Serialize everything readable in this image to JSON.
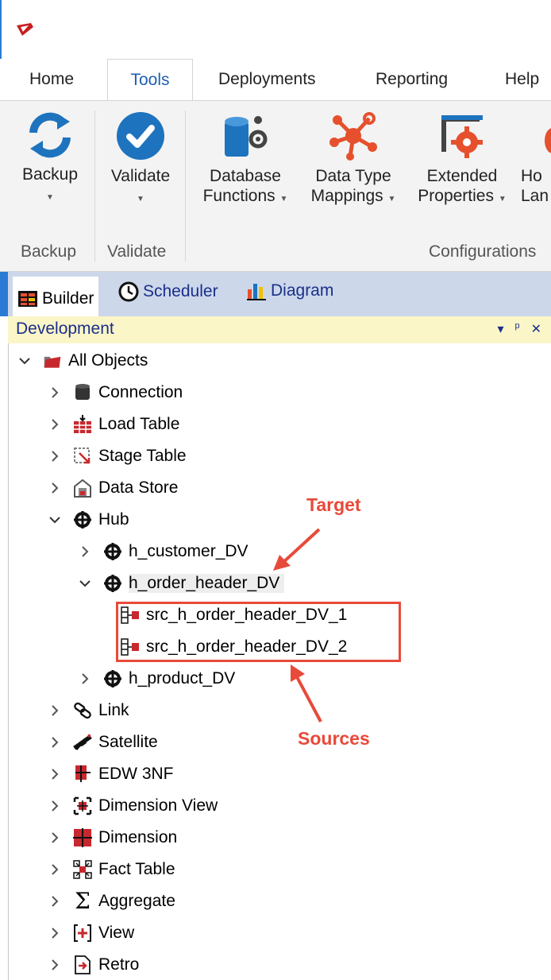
{
  "ribbon": {
    "tabs": [
      "Home",
      "Tools",
      "Deployments",
      "Reporting",
      "Help"
    ],
    "buttons": {
      "backup": "Backup",
      "validate": "Validate",
      "db_functions_1": "Database",
      "db_functions_2": "Functions",
      "dtm_1": "Data Type",
      "dtm_2": "Mappings",
      "ext_1": "Extended",
      "ext_2": "Properties",
      "hl_1": "Ho",
      "hl_2": "Lan"
    },
    "groups": [
      "Backup",
      "Validate",
      "Configurations"
    ]
  },
  "panel_tabs": [
    "Builder",
    "Scheduler",
    "Diagram"
  ],
  "panel": {
    "title": "Development",
    "controls": [
      "▾",
      "ᵖ",
      "✕"
    ]
  },
  "tree": {
    "root": "All Objects",
    "items": {
      "connection": "Connection",
      "load_table": "Load Table",
      "stage_table": "Stage Table",
      "data_store": "Data Store",
      "hub": "Hub",
      "h_customer": "h_customer_DV",
      "h_order_header": "h_order_header_DV",
      "src1": "src_h_order_header_DV_1",
      "src2": "src_h_order_header_DV_2",
      "h_product": "h_product_DV",
      "link": "Link",
      "satellite": "Satellite",
      "edw": "EDW 3NF",
      "dim_view": "Dimension View",
      "dimension": "Dimension",
      "fact": "Fact Table",
      "aggregate": "Aggregate",
      "view": "View",
      "retro": "Retro"
    }
  },
  "annotations": {
    "target": "Target",
    "sources": "Sources"
  },
  "colors": {
    "accent": "#2b7bd4",
    "annotation": "#e84a3a",
    "icon_blue": "#1e73be",
    "icon_red": "#e6502d"
  }
}
